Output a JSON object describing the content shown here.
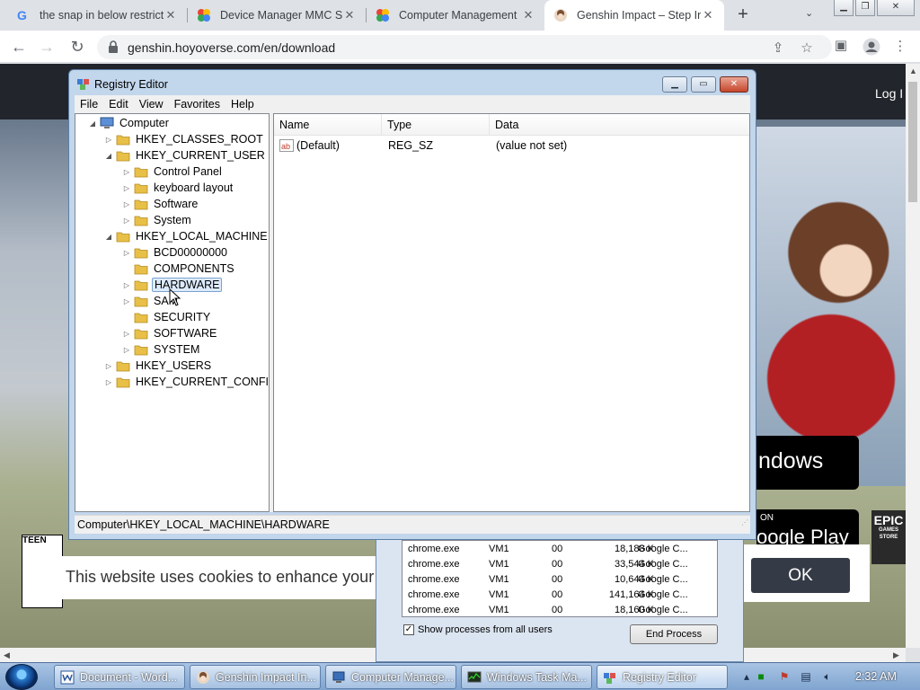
{
  "browser": {
    "tabs": [
      {
        "title": "the snap in below restrict",
        "icon": "google-icon",
        "close": "✕"
      },
      {
        "title": "Device Manager MMC Sn",
        "icon": "mmc-icon",
        "close": "✕"
      },
      {
        "title": "Computer Management",
        "icon": "mmc-icon",
        "close": "✕"
      },
      {
        "title": "Genshin Impact – Step In",
        "icon": "genshin-icon",
        "close": "✕"
      }
    ],
    "new_tab": "+",
    "tab_menu": "⌄",
    "url": "genshin.hoyoverse.com/en/download"
  },
  "webpage": {
    "login": "Log I",
    "windows_btn": "ndows",
    "play_on": "ON",
    "play_store": "oogle Play",
    "epic_line1": "EPIC",
    "epic_line2": "GAMES",
    "epic_line3": "STORE",
    "teen": "TEEN",
    "cookie_text": "This website uses cookies to enhance your b",
    "ok": "OK"
  },
  "regedit": {
    "title": "Registry Editor",
    "menu": [
      "File",
      "Edit",
      "View",
      "Favorites",
      "Help"
    ],
    "tree": [
      {
        "label": "Computer",
        "exp": "◢",
        "level": 0
      },
      {
        "label": "HKEY_CLASSES_ROOT",
        "exp": "▷",
        "level": 1
      },
      {
        "label": "HKEY_CURRENT_USER",
        "exp": "◢",
        "level": 1
      },
      {
        "label": "Control Panel",
        "exp": "▷",
        "level": 2
      },
      {
        "label": "keyboard layout",
        "exp": "▷",
        "level": 2
      },
      {
        "label": "Software",
        "exp": "▷",
        "level": 2
      },
      {
        "label": "System",
        "exp": "▷",
        "level": 2
      },
      {
        "label": "HKEY_LOCAL_MACHINE",
        "exp": "◢",
        "level": 1
      },
      {
        "label": "BCD00000000",
        "exp": "▷",
        "level": 2
      },
      {
        "label": "COMPONENTS",
        "exp": "",
        "level": 2
      },
      {
        "label": "HARDWARE",
        "exp": "▷",
        "level": 2,
        "selected": true
      },
      {
        "label": "SAM",
        "exp": "▷",
        "level": 2
      },
      {
        "label": "SECURITY",
        "exp": "",
        "level": 2
      },
      {
        "label": "SOFTWARE",
        "exp": "▷",
        "level": 2
      },
      {
        "label": "SYSTEM",
        "exp": "▷",
        "level": 2
      },
      {
        "label": "HKEY_USERS",
        "exp": "▷",
        "level": 1
      },
      {
        "label": "HKEY_CURRENT_CONFIG",
        "exp": "▷",
        "level": 1
      }
    ],
    "columns": [
      "Name",
      "Type",
      "Data"
    ],
    "values": [
      {
        "name": "(Default)",
        "type": "REG_SZ",
        "data": "(value not set)",
        "icon": "ab"
      }
    ],
    "status": "Computer\\HKEY_LOCAL_MACHINE\\HARDWARE"
  },
  "taskmgr": {
    "rows": [
      [
        "chrome.exe",
        "VM1",
        "00",
        "18,188 K",
        "Google C..."
      ],
      [
        "chrome.exe",
        "VM1",
        "00",
        "33,544 K",
        "Google C..."
      ],
      [
        "chrome.exe",
        "VM1",
        "00",
        "10,644 K",
        "Google C..."
      ],
      [
        "chrome.exe",
        "VM1",
        "00",
        "141,164 K",
        "Google C..."
      ],
      [
        "chrome.exe",
        "VM1",
        "00",
        "18,160 K",
        "Google C..."
      ]
    ],
    "show_all": "Show processes from all users",
    "end_process": "End Process"
  },
  "taskbar": {
    "items": [
      {
        "label": "Document - Word...",
        "icon": "word-icon"
      },
      {
        "label": "Genshin Impact In...",
        "icon": "genshin-icon"
      },
      {
        "label": "Computer Manage...",
        "icon": "computer-management-icon"
      },
      {
        "label": "Windows Task Ma...",
        "icon": "task-manager-icon"
      },
      {
        "label": "Registry Editor",
        "icon": "registry-editor-icon"
      }
    ],
    "clock": "2:32 AM"
  },
  "colors": {
    "selection": "#dcebfc",
    "folder": "#e8c048",
    "ok_button": "#353b46",
    "taskbar": "#8fb0d8"
  }
}
